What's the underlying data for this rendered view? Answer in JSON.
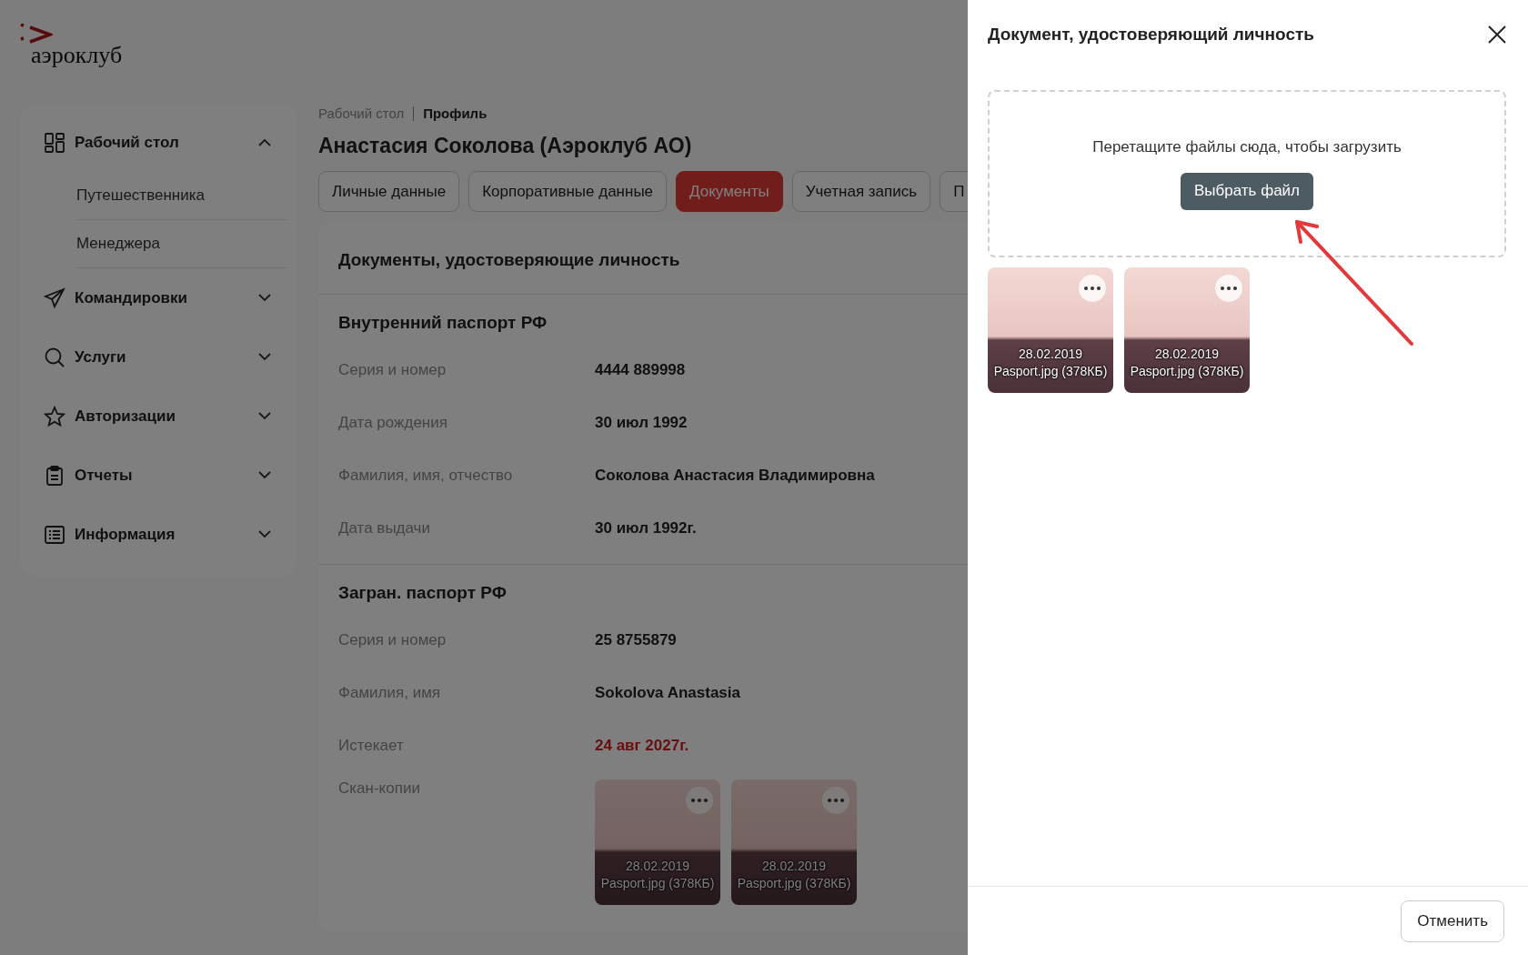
{
  "logo": {
    "text": "аэроклуб"
  },
  "sidebar": {
    "items": [
      {
        "label": "Рабочий стол",
        "expanded": true,
        "children": [
          {
            "label": "Путешественника"
          },
          {
            "label": "Менеджера"
          }
        ]
      },
      {
        "label": "Командировки",
        "expanded": false
      },
      {
        "label": "Услуги",
        "expanded": false
      },
      {
        "label": "Авторизации",
        "expanded": false
      },
      {
        "label": "Отчеты",
        "expanded": false
      },
      {
        "label": "Информация",
        "expanded": false
      }
    ]
  },
  "breadcrumbs": [
    {
      "label": "Рабочий стол",
      "current": false
    },
    {
      "label": "Профиль",
      "current": true
    }
  ],
  "page_title": "Анастасия Соколова (Аэроклуб АО)",
  "tabs": [
    {
      "label": "Личные данные",
      "selected": false
    },
    {
      "label": "Корпоративные данные",
      "selected": false
    },
    {
      "label": "Документы",
      "selected": true
    },
    {
      "label": "Учетная запись",
      "selected": false
    },
    {
      "label": "П",
      "selected": false
    }
  ],
  "card": {
    "title": "Документы, удостоверяющие личность",
    "sections": [
      {
        "title": "Внутренний паспорт РФ",
        "rows": [
          {
            "label": "Серия и номер",
            "value": "4444 889998",
            "alert": false
          },
          {
            "label": "Дата рождения",
            "value": "30 июл 1992",
            "alert": false
          },
          {
            "label": "Фамилия, имя, отчество",
            "value": "Соколова Анастасия Владимировна",
            "alert": false
          },
          {
            "label": "Дата выдачи",
            "value": "30 июл 1992г.",
            "alert": false
          }
        ]
      },
      {
        "title": "Загран. паспорт РФ",
        "rows": [
          {
            "label": "Серия и номер",
            "value": "25 8755879",
            "alert": false
          },
          {
            "label": "Фамилия, имя",
            "value": "Sokolova Anastasia",
            "alert": false
          },
          {
            "label": "Истекает",
            "value": "24 авг 2027г.",
            "alert": true
          }
        ],
        "scans_label": "Скан-копии",
        "scans": [
          {
            "date": "28.02.2019",
            "file": "Pasport.jpg (378КБ)"
          },
          {
            "date": "28.02.2019",
            "file": "Pasport.jpg (378КБ)"
          }
        ]
      }
    ]
  },
  "drawer": {
    "title": "Документ, удостоверяющий личность",
    "dropzone_text": "Перетащите файлы сюда, чтобы загрузить",
    "choose_button": "Выбрать файл",
    "files": [
      {
        "date": "28.02.2019",
        "file": "Pasport.jpg (378КБ)"
      },
      {
        "date": "28.02.2019",
        "file": "Pasport.jpg (378КБ)"
      }
    ],
    "cancel_button": "Отменить"
  }
}
